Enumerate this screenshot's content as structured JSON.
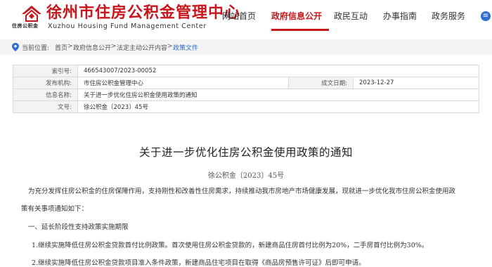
{
  "header": {
    "site_title": "徐州市住房公积金管理中心",
    "site_subtitle": "Xuzhou Housing Fund Management Center",
    "logo_caption": "住房公积金",
    "nav": [
      {
        "label": "网站首页"
      },
      {
        "label": "政府信息公开"
      },
      {
        "label": "政民互动"
      },
      {
        "label": "办事指南"
      },
      {
        "label": "政务服务"
      }
    ],
    "menu_glyph": "≡"
  },
  "breadcrumb": {
    "prefix": "当前位置:",
    "items": [
      "首页",
      "政府信息公开",
      "法定主动公开内容",
      "政策文件"
    ],
    "separator": ">"
  },
  "meta": {
    "index_label": "索引号:",
    "index_value": "466543007/2023-00052",
    "publisher_label": "发布机构:",
    "publisher_value": "市住房公积金管理中心",
    "date_label": "成文日期:",
    "date_value": "2023-12-27",
    "name_label": "信息名称:",
    "name_value": "关于进一步优化住房公积金使用政策的通知",
    "docno_label": "文号:",
    "docno_value": "徐公积金〔2023〕45号"
  },
  "article": {
    "title": "关于进一步优化住房公积金使用政策的通知",
    "doc_number": "徐公积金〔2023〕45号",
    "paragraphs": [
      "为充分发挥住房公积金的住房保障作用，支持刚性和改善性住房需求，持续推动我市房地产市场健康发展，现就进一步优化我市住房公积金使用政",
      "策有关事项通知如下：",
      "一、延长阶段性支持政策实施期限",
      "1.继续实施降低住房公积金贷款首付比例政策。首次使用住房公积金贷款的，新建商品住房首付比例为20%，二手房首付比例为30%。",
      "2.继续实施降低住房公积金贷款项目准入条件政策，新建商品住宅项目在取得《商品房预售许可证》后即可申请。"
    ]
  },
  "colors": {
    "brand_red": "#c8161d",
    "link_blue": "#2e6fd0"
  }
}
